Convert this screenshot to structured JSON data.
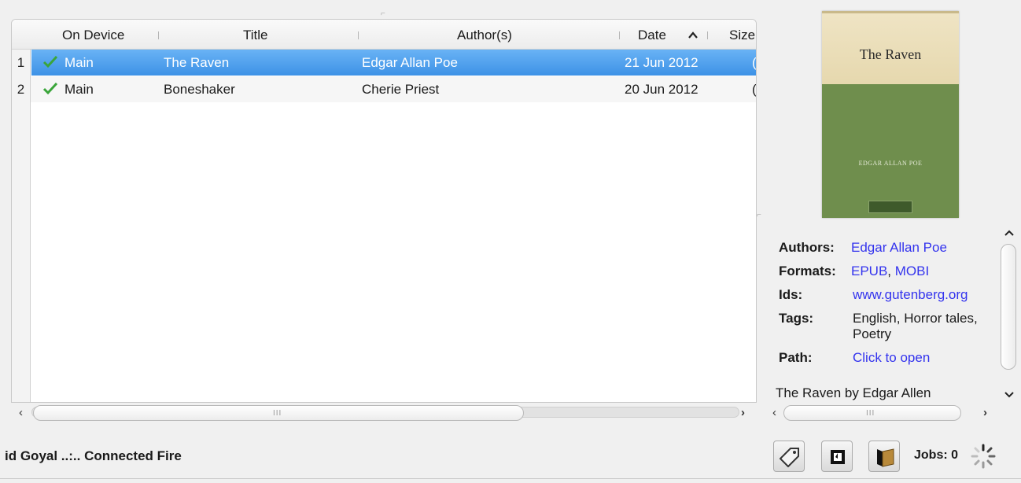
{
  "table": {
    "columns": {
      "on_device": "On Device",
      "title": "Title",
      "authors": "Author(s)",
      "date": "Date",
      "size": "Size"
    },
    "sort_indicator": "up-arrow-icon",
    "rows": [
      {
        "num": "1",
        "on_device": "Main",
        "title": "The Raven",
        "authors": "Edgar Allan Poe",
        "date": "21 Jun 2012",
        "size": "(",
        "selected": true
      },
      {
        "num": "2",
        "on_device": "Main",
        "title": "Boneshaker",
        "authors": "Cherie Priest",
        "date": "20 Jun 2012",
        "size": "(",
        "selected": false
      }
    ],
    "scroll_grip": "III"
  },
  "cover": {
    "title": "The Raven",
    "author": "EDGAR ALLAN POE"
  },
  "details": {
    "authors_label": "Authors:",
    "authors_value": "Edgar Allan Poe",
    "formats_label": "Formats:",
    "formats_epub": "EPUB",
    "formats_sep": ", ",
    "formats_mobi": "MOBI",
    "ids_label": "Ids:",
    "ids_value": "www.gutenberg.org",
    "tags_label": "Tags:",
    "tags_line1": "English, Horror tales,",
    "tags_line2": "Poetry",
    "path_label": "Path:",
    "path_value": "Click to open",
    "description": "The Raven by Edgar Allen",
    "scroll_grip": "III"
  },
  "status": {
    "text": "id Goyal ..:.. Connected Fire",
    "jobs": "Jobs: 0"
  },
  "colors": {
    "selection": "#4a9cea",
    "link": "#3333ee",
    "check": "#3aa53a"
  }
}
